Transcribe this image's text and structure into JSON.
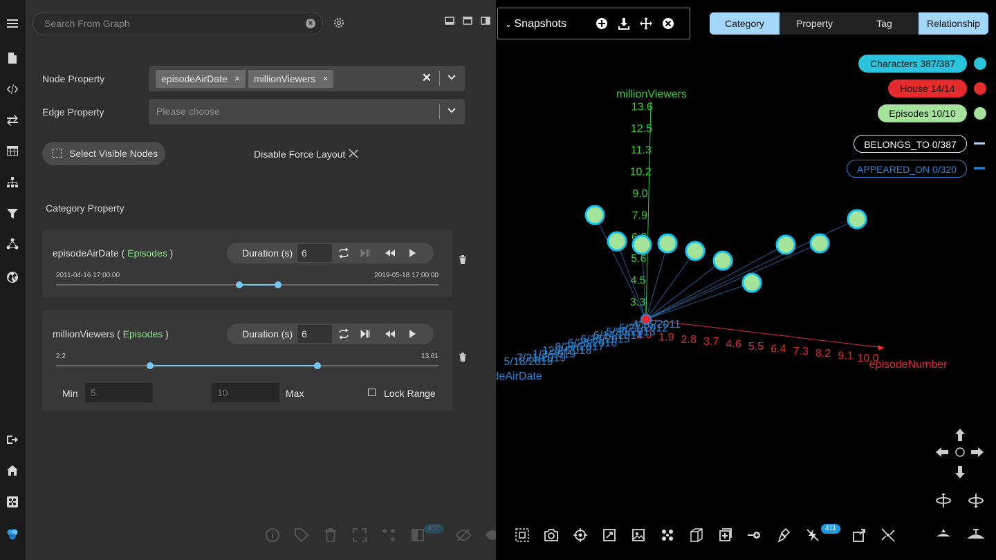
{
  "sidebar": {
    "icons": [
      "menu-icon",
      "file-icon",
      "code-icon",
      "transfer-icon",
      "table-icon",
      "hierarchy-icon",
      "filter-icon",
      "graph-icon",
      "globe-icon",
      "sign-out-icon",
      "home-icon",
      "command-icon",
      "logo-icon"
    ]
  },
  "search": {
    "placeholder": "Search From Graph"
  },
  "node_property": {
    "label": "Node Property",
    "chips": [
      "episodeAirDate",
      "millionViewers"
    ]
  },
  "edge_property": {
    "label": "Edge Property",
    "placeholder": "Please choose"
  },
  "actions": {
    "select_visible": "Select Visible Nodes",
    "disable_force": "Disable Force Layout"
  },
  "category_property": {
    "title": "Category Property",
    "filters": [
      {
        "name": "episodeAirDate",
        "category": "Episodes",
        "duration_label": "Duration (s)",
        "duration": "6",
        "range_min_label": "2011-04-16 17:00:00",
        "range_max_label": "2019-05-18 17:00:00",
        "selected_start_fraction": 0.48,
        "selected_end_fraction": 0.58
      },
      {
        "name": "millionViewers",
        "category": "Episodes",
        "duration_label": "Duration (s)",
        "duration": "6",
        "range_min_label": "2.2",
        "range_max_label": "13.61",
        "selected_start_fraction": 0.246,
        "selected_end_fraction": 0.684,
        "min_label": "Min",
        "min_placeholder": "5",
        "max_label": "Max",
        "max_placeholder": "10",
        "lock_range_label": "Lock Range"
      }
    ]
  },
  "toolbar_left": {
    "badge_count": "410"
  },
  "snapshots": {
    "title": "Snapshots"
  },
  "tabs": [
    "Category",
    "Property",
    "Tag",
    "Relationship"
  ],
  "active_tabs": [
    "Category",
    "Relationship"
  ],
  "legend": {
    "categories": [
      {
        "label": "Characters 387/387",
        "color": "#29c4dc"
      },
      {
        "label": "House 14/14",
        "color": "#e52b2b"
      },
      {
        "label": "Episodes 10/10",
        "color": "#a4e39a"
      }
    ],
    "relationships": [
      {
        "label": "BELONGS_TO 0/387",
        "color": "#b8d6f5"
      },
      {
        "label": "APPEARED_ON 0/320",
        "color": "#2a86d6"
      }
    ]
  },
  "chart_data": {
    "type": "scatter",
    "y_axis": {
      "label": "millionViewers",
      "ticks": [
        "3.3",
        "4.5",
        "5.6",
        "6.8",
        "7.9",
        "9.0",
        "10.2",
        "11.3",
        "12.5",
        "13.6"
      ],
      "color": "#37d13a"
    },
    "x_axis": {
      "label": "episodeNumber",
      "ticks": [
        "1.0",
        "1.9",
        "2.8",
        "3.7",
        "4.6",
        "5.5",
        "6.4",
        "7.3",
        "8.2",
        "9.1",
        "10.0"
      ],
      "color": "#e52b2b"
    },
    "z_axis": {
      "label": "episodeAirDate",
      "ticks": [
        "4/16/2011",
        "5/21/2012",
        "5/30/2013",
        "6/14/2014",
        "6/13/2015",
        "6/25/2016",
        "8/27/2017",
        "12/2/2018",
        "1/2/2019",
        "7/21/2019",
        "5/18/2019"
      ],
      "color": "#2a86d6"
    },
    "node_count": 10,
    "toolbar_badge": "411"
  }
}
